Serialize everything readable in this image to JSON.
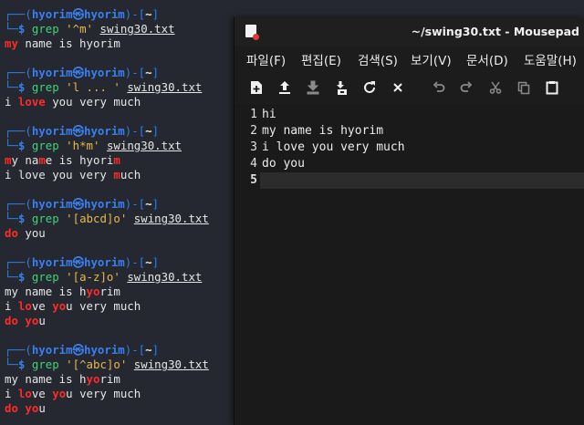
{
  "terminal": {
    "blocks": [
      {
        "user": "hyorim",
        "host": "hyorim",
        "dir": "~",
        "cmd": "grep",
        "pattern": "'^m'",
        "file": "swing30.txt",
        "output": [
          [
            [
              "my",
              "hl"
            ],
            [
              " name is hyorim",
              ""
            ]
          ]
        ]
      },
      {
        "user": "hyorim",
        "host": "hyorim",
        "dir": "~",
        "cmd": "grep",
        "pattern": "'l ... '",
        "file": "swing30.txt",
        "output": [
          [
            [
              "i ",
              ""
            ],
            [
              "love",
              "hl"
            ],
            [
              " you very much",
              ""
            ]
          ]
        ]
      },
      {
        "user": "hyorim",
        "host": "hyorim",
        "dir": "~",
        "cmd": "grep",
        "pattern": "'h*m'",
        "file": "swing30.txt",
        "output": [
          [
            [
              "m",
              "hl"
            ],
            [
              "y na",
              ""
            ],
            [
              "m",
              "hl"
            ],
            [
              "e is hyori",
              ""
            ],
            [
              "m",
              "hl"
            ]
          ],
          [
            [
              "i love you very ",
              ""
            ],
            [
              "m",
              "hl"
            ],
            [
              "uch",
              ""
            ]
          ]
        ]
      },
      {
        "user": "hyorim",
        "host": "hyorim",
        "dir": "~",
        "cmd": "grep",
        "pattern": "'[abcd]o'",
        "file": "swing30.txt",
        "output": [
          [
            [
              "do",
              "hl"
            ],
            [
              " you",
              ""
            ]
          ]
        ]
      },
      {
        "user": "hyorim",
        "host": "hyorim",
        "dir": "~",
        "cmd": "grep",
        "pattern": "'[a-z]o'",
        "file": "swing30.txt",
        "output": [
          [
            [
              "my name is h",
              ""
            ],
            [
              "yo",
              "hl"
            ],
            [
              "rim",
              ""
            ]
          ],
          [
            [
              "i ",
              ""
            ],
            [
              "lo",
              "hl"
            ],
            [
              "ve ",
              ""
            ],
            [
              "yo",
              "hl"
            ],
            [
              "u very much",
              ""
            ]
          ],
          [
            [
              "do",
              "hl"
            ],
            [
              " ",
              ""
            ],
            [
              "yo",
              "hl"
            ],
            [
              "u",
              ""
            ]
          ]
        ]
      },
      {
        "user": "hyorim",
        "host": "hyorim",
        "dir": "~",
        "cmd": "grep",
        "pattern": "'[^abc]o'",
        "file": "swing30.txt",
        "output": [
          [
            [
              "my name is h",
              ""
            ],
            [
              "yo",
              "hl"
            ],
            [
              "rim",
              ""
            ]
          ],
          [
            [
              "i ",
              ""
            ],
            [
              "lo",
              "hl"
            ],
            [
              "ve ",
              ""
            ],
            [
              "yo",
              "hl"
            ],
            [
              "u very much",
              ""
            ]
          ],
          [
            [
              "do",
              "hl"
            ],
            [
              " ",
              ""
            ],
            [
              "yo",
              "hl"
            ],
            [
              "u",
              ""
            ]
          ]
        ]
      }
    ],
    "frame_top": "┌──(",
    "at_glyph": "㉿",
    "frame_mid": ")-[",
    "frame_end": "]",
    "frame_bottom": "└─",
    "prompt_symbol": "$"
  },
  "mousepad": {
    "title": "~/swing30.txt - Mousepad",
    "menus": [
      "파일(F)",
      "편집(E)",
      "검색(S)",
      "보기(V)",
      "문서(D)",
      "도움말(H)"
    ],
    "toolbar": [
      {
        "name": "new-document-icon",
        "enabled": true
      },
      {
        "name": "open-file-icon",
        "enabled": true
      },
      {
        "name": "save-icon",
        "enabled": false
      },
      {
        "name": "save-as-icon",
        "enabled": true
      },
      {
        "name": "reload-icon",
        "enabled": true
      },
      {
        "name": "close-icon",
        "enabled": true
      },
      {
        "name": "undo-icon",
        "enabled": false
      },
      {
        "name": "redo-icon",
        "enabled": false
      },
      {
        "name": "cut-icon",
        "enabled": false
      },
      {
        "name": "copy-icon",
        "enabled": false
      },
      {
        "name": "paste-icon",
        "enabled": true
      }
    ],
    "lines": [
      {
        "num": "1",
        "text": "hi"
      },
      {
        "num": "2",
        "text": "my name is hyorim"
      },
      {
        "num": "3",
        "text": "i love you very much"
      },
      {
        "num": "4",
        "text": "do you"
      },
      {
        "num": "5",
        "text": ""
      }
    ],
    "current_line": 5
  }
}
